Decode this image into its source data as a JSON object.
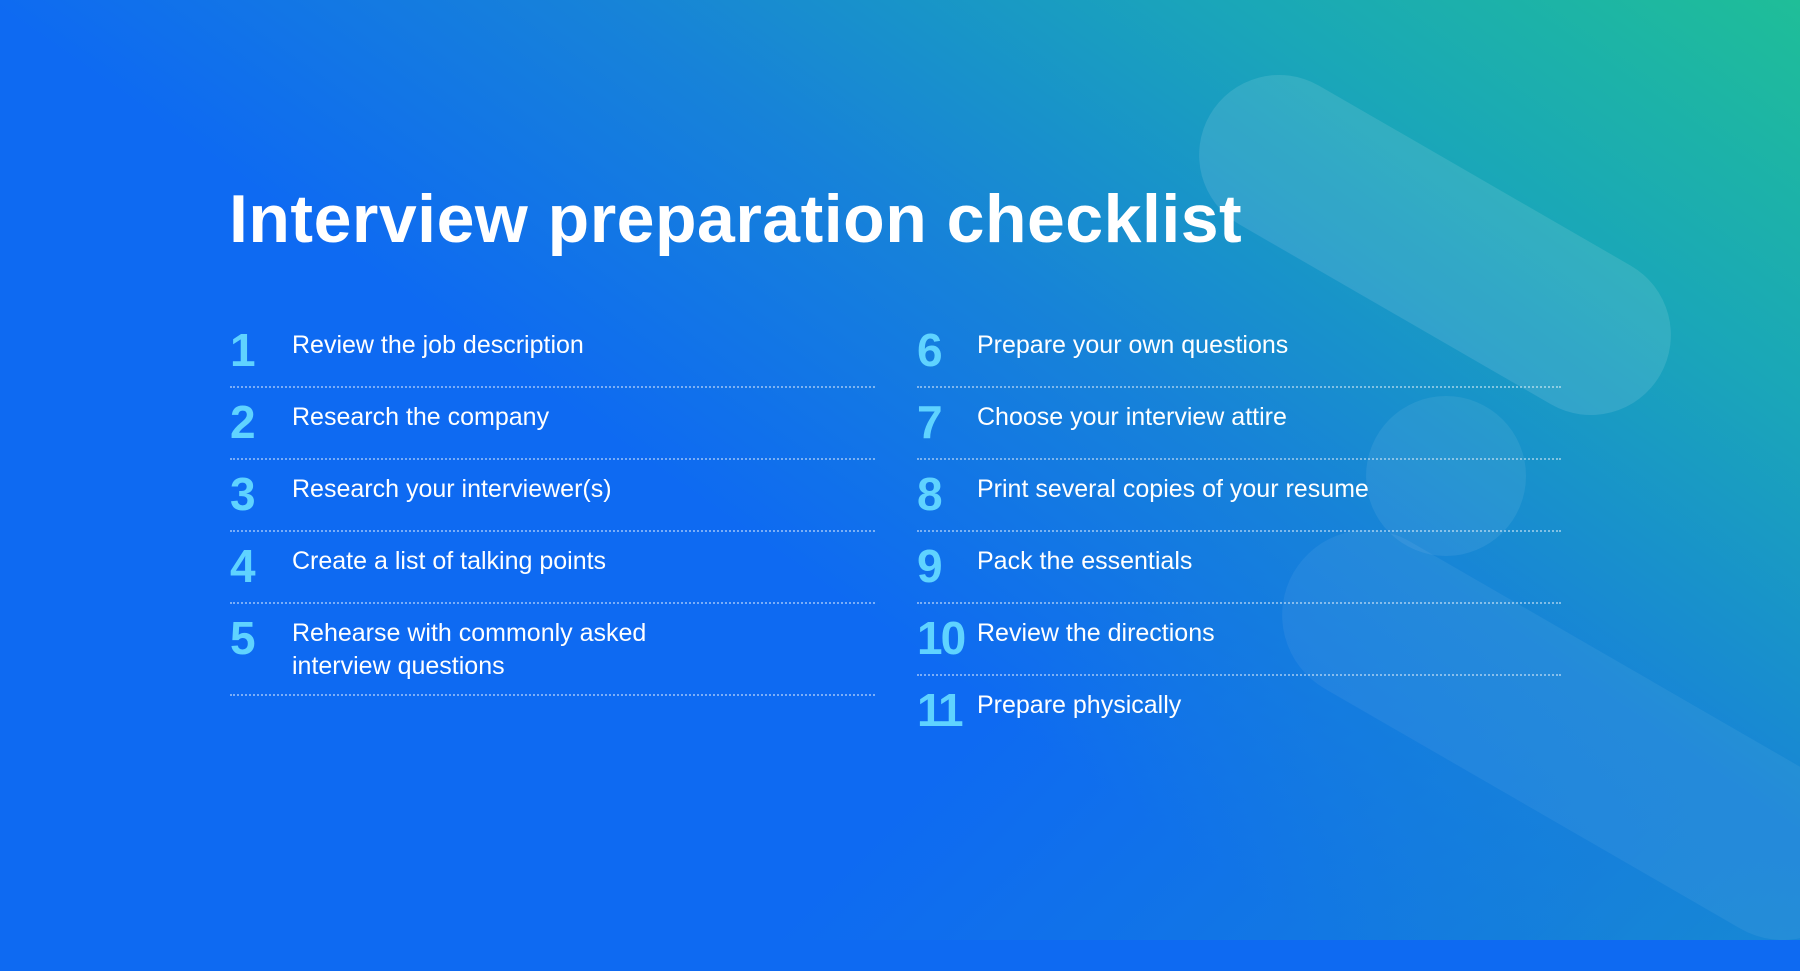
{
  "title": "Interview preparation checklist",
  "colors": {
    "background": "#0e6af2",
    "gradient_accent": "#1fbe98",
    "number": "#5fd3ff",
    "text": "#ffffff"
  },
  "checklist": {
    "left": [
      {
        "number": "1",
        "text": "Review the job description"
      },
      {
        "number": "2",
        "text": "Research the company"
      },
      {
        "number": "3",
        "text": "Research your interviewer(s)"
      },
      {
        "number": "4",
        "text": "Create a list of talking points"
      },
      {
        "number": "5",
        "text": "Rehearse with commonly asked interview questions"
      }
    ],
    "right": [
      {
        "number": "6",
        "text": "Prepare your own questions"
      },
      {
        "number": "7",
        "text": "Choose your interview attire"
      },
      {
        "number": "8",
        "text": "Print several copies of your resume"
      },
      {
        "number": "9",
        "text": "Pack the essentials"
      },
      {
        "number": "10",
        "text": "Review the directions"
      },
      {
        "number": "11",
        "text": "Prepare physically"
      }
    ]
  }
}
